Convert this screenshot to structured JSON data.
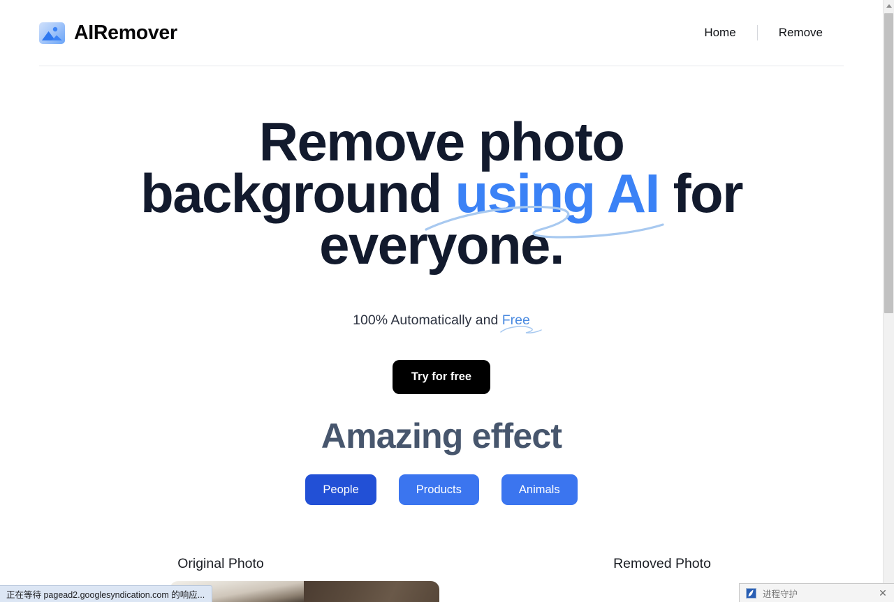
{
  "header": {
    "brand_name": "AIRemover",
    "brand_icon": "image-photo-icon",
    "nav": [
      {
        "label": "Home"
      },
      {
        "label": "Remove"
      }
    ]
  },
  "hero": {
    "title_part1": "Remove photo background ",
    "title_highlight": "using AI",
    "title_part2": " for everyone.",
    "subtitle_prefix": "100% Automatically and ",
    "subtitle_highlight": "Free",
    "cta_label": "Try for free"
  },
  "effect": {
    "title": "Amazing effect",
    "tabs": [
      {
        "label": "People",
        "active": true
      },
      {
        "label": "Products",
        "active": false
      },
      {
        "label": "Animals",
        "active": false
      }
    ]
  },
  "compare": {
    "original_label": "Original Photo",
    "removed_label": "Removed Photo"
  },
  "browser": {
    "status_text": "正在等待 pagead2.googlesyndication.com 的响应..."
  },
  "notification": {
    "title": "进程守护",
    "close_label": "✕",
    "icon": "shield-app-icon"
  },
  "colors": {
    "heading": "#121a2d",
    "accent_blue": "#3b82f6",
    "link_blue": "#4a8ae0",
    "effect_title": "#47566d",
    "pill_active": "#2250d6",
    "pill_idle": "#3b75ef",
    "cta_bg": "#000000",
    "swoosh": "#a8c9f0"
  }
}
